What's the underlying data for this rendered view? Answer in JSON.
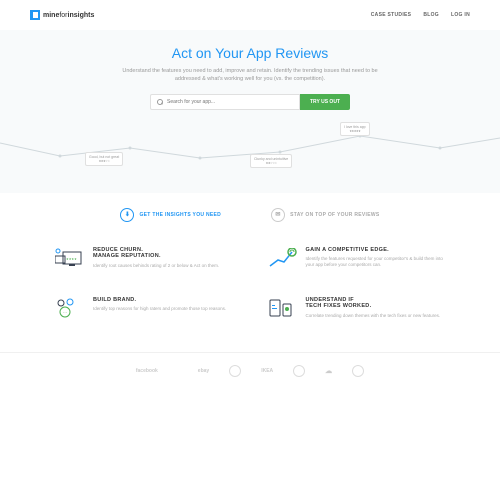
{
  "header": {
    "logo_bold": "mine",
    "logo_light": "for",
    "logo_end": "insights",
    "nav": [
      "CASE STUDIES",
      "BLOG",
      "LOG IN"
    ]
  },
  "hero": {
    "title": "Act on Your App Reviews",
    "subtitle": "Understand the features you need to add, improve and retain. Identify the trending issues that need to be addressed & what's working well for you (vs. the competition).",
    "search_placeholder": "Search for your app...",
    "cta": "TRY US OUT",
    "bubbles": [
      {
        "text": "Good, but not great",
        "stars": "★★★☆☆"
      },
      {
        "text": "Clunky and unintuitive",
        "stars": "★★☆☆☆"
      },
      {
        "text": "I love this app",
        "stars": "★★★★★"
      }
    ]
  },
  "tabs": [
    {
      "icon": "⬇",
      "label": "GET THE INSIGHTS YOU NEED"
    },
    {
      "icon": "✉",
      "label": "STAY ON TOP OF YOUR REVIEWS"
    }
  ],
  "features": [
    {
      "title": "REDUCE CHURN.\nMANAGE REPUTATION.",
      "desc": "Identify root causes behinds rating of 2 or below & Act on them."
    },
    {
      "title": "GAIN A COMPETITIVE EDGE.",
      "desc": "Identify the features requested for your competitor's & build them into your app before your competitors can."
    },
    {
      "title": "BUILD BRAND.",
      "desc": "Identify top reasons for high raters and promote those top reasons."
    },
    {
      "title": "UNDERSTAND IF\nTECH FIXES WORKED.",
      "desc": "Correlate trending down themes with the tech fixes or new features."
    }
  ],
  "brands": [
    "facebook",
    "",
    "ebay",
    "intel",
    "IKEA",
    "",
    "",
    ""
  ]
}
